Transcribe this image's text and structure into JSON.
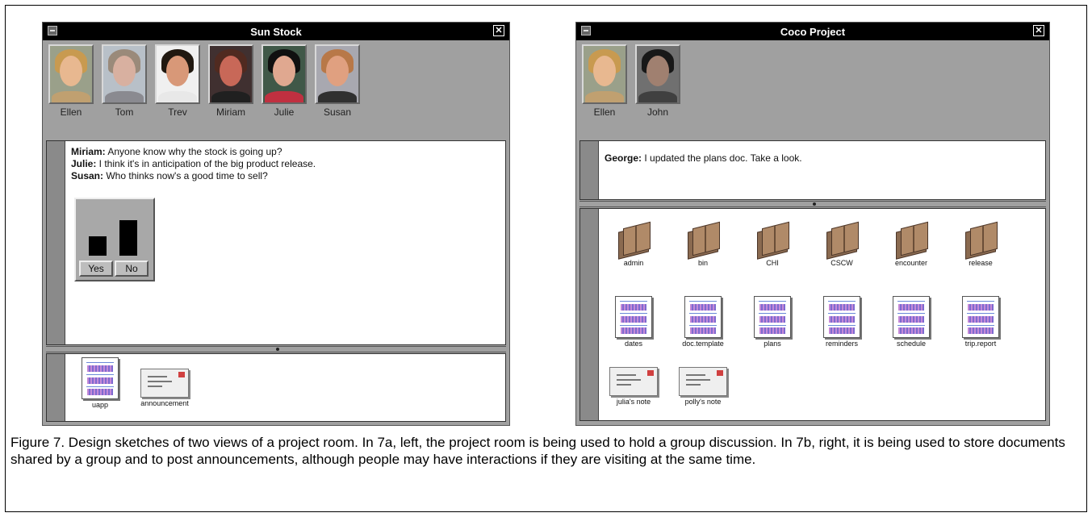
{
  "left_window": {
    "title": "Sun Stock",
    "members": [
      {
        "name": "Ellen"
      },
      {
        "name": "Tom"
      },
      {
        "name": "Trev"
      },
      {
        "name": "Miriam"
      },
      {
        "name": "Julie"
      },
      {
        "name": "Susan"
      }
    ],
    "chat": [
      {
        "speaker": "Miriam:",
        "text": " Anyone know why the stock is going up?"
      },
      {
        "speaker": "Julie:",
        "text": " I think it's in anticipation of the big product release."
      },
      {
        "speaker": "Susan:",
        "text": " Who thinks now's a good time to sell?"
      }
    ],
    "vote": {
      "yes_label": "Yes",
      "no_label": "No",
      "yes_value": 0.55,
      "no_value": 1.0
    },
    "files": [
      {
        "label": "uapp",
        "kind": "doc"
      },
      {
        "label": "announcement",
        "kind": "note"
      }
    ]
  },
  "right_window": {
    "title": "Coco Project",
    "members": [
      {
        "name": "Ellen"
      },
      {
        "name": "John"
      }
    ],
    "chat": [
      {
        "speaker": "George:",
        "text": " I updated the plans doc. Take a look."
      }
    ],
    "folders": [
      {
        "label": "admin"
      },
      {
        "label": "bin"
      },
      {
        "label": "CHI"
      },
      {
        "label": "CSCW"
      },
      {
        "label": "encounter"
      },
      {
        "label": "release"
      }
    ],
    "docs": [
      {
        "label": "dates"
      },
      {
        "label": "doc.template"
      },
      {
        "label": "plans"
      },
      {
        "label": "reminders"
      },
      {
        "label": "schedule"
      },
      {
        "label": "trip.report"
      }
    ],
    "notes": [
      {
        "label": "julia's note"
      },
      {
        "label": "polly's note"
      }
    ]
  },
  "caption": "Figure 7. Design sketches of two views of a project room. In 7a, left, the project room is being used to hold a group discussion. In 7b, right, it is being used to store documents shared by a group and to post announcements, although people may have interactions if they are visiting at the same time.",
  "colors": {
    "window_bg": "#a0a0a0",
    "titlebar": "#000000",
    "pane": "#ffffff"
  }
}
